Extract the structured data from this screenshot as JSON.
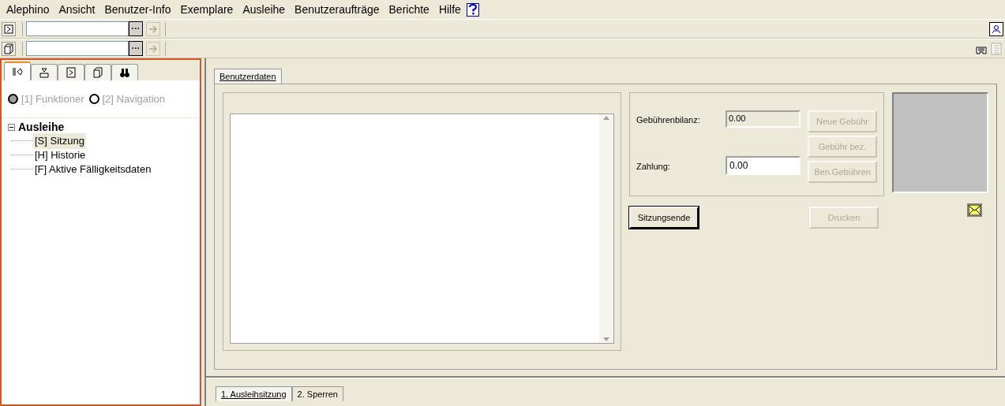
{
  "menu": [
    {
      "label": "Alephino"
    },
    {
      "label": "Ansicht"
    },
    {
      "label": "Benutzer-Info"
    },
    {
      "label": "Exemplare"
    },
    {
      "label": "Ausleihe"
    },
    {
      "label": "Benutzeraufträge"
    },
    {
      "label": "Berichte"
    },
    {
      "label": "Hilfe"
    }
  ],
  "toolbars": [
    {
      "browse": "···",
      "arrow_disabled": true
    },
    {
      "browse": "···",
      "arrow_disabled": true
    }
  ],
  "side_tabs": [
    {
      "selected": true
    },
    {
      "selected": false
    },
    {
      "selected": false
    },
    {
      "selected": false
    },
    {
      "selected": false
    }
  ],
  "radios": [
    {
      "label": "[1] Funktioner",
      "selected": true,
      "disabled": true
    },
    {
      "label": "[2] Navigation",
      "selected": false,
      "disabled": true
    }
  ],
  "tree": [
    {
      "label": "Ausleihe",
      "expanded": true,
      "children": [
        {
          "label": "[S] Sitzung",
          "selected": true
        },
        {
          "label": "[H] Historie",
          "selected": false
        },
        {
          "label": "[F] Aktive Fälligkeitsdaten",
          "selected": false
        }
      ]
    }
  ],
  "top_tabs": [
    {
      "label": "Benutzerdaten",
      "selected": true
    }
  ],
  "fees": {
    "balance_label": "Gebührenbilanz:",
    "balance_value": "0.00",
    "payment_label": "Zahlung:",
    "payment_value": "0.00"
  },
  "fee_buttons": [
    {
      "label": "Neue Gebühr",
      "disabled": true
    },
    {
      "label": "Gebühr bez.",
      "disabled": true
    },
    {
      "label": "Ben.Gebühren",
      "disabled": true
    }
  ],
  "actions": [
    {
      "label": "Sitzungsende",
      "disabled": false
    },
    {
      "label": "Drucken",
      "disabled": true
    }
  ],
  "bottom_tabs": [
    {
      "label": "1. Ausleihsitzung",
      "selected": true
    },
    {
      "label": "2. Sperren",
      "selected": false
    }
  ]
}
